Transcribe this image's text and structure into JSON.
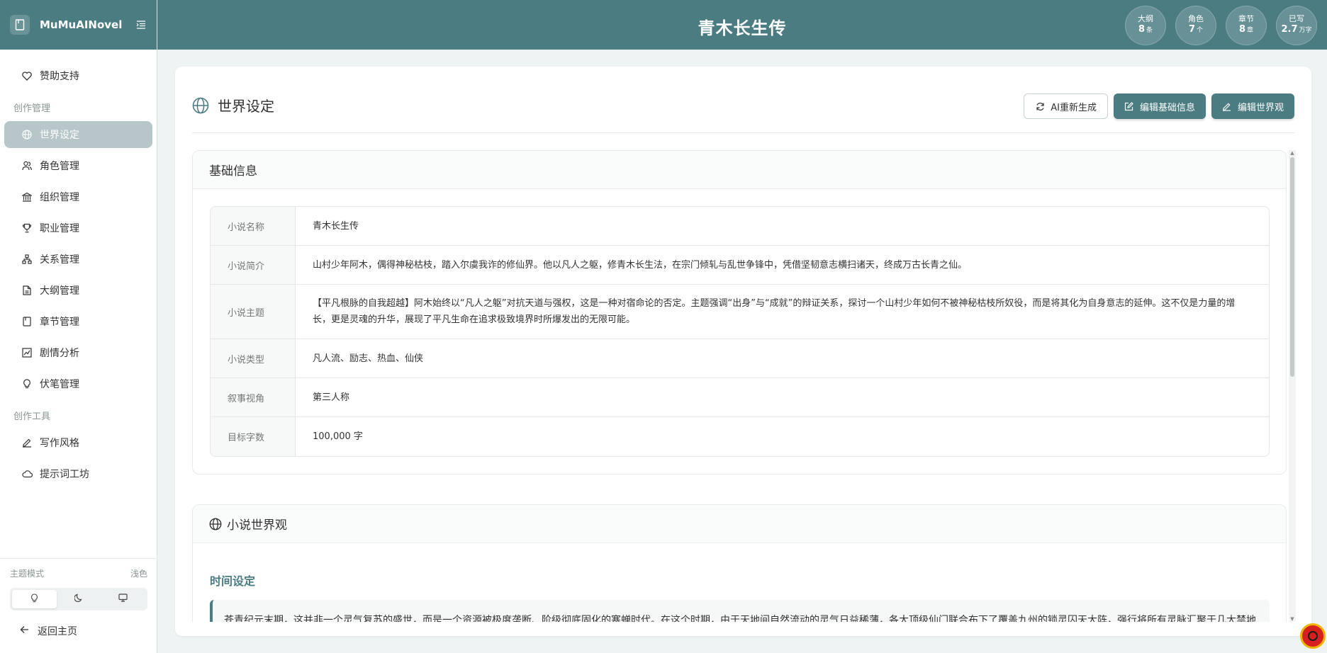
{
  "sidebar": {
    "brand": "MuMuAINovel",
    "items_top": [
      {
        "label": "赞助支持",
        "icon": "heart-icon"
      }
    ],
    "group1": "创作管理",
    "items_manage": [
      {
        "label": "世界设定",
        "icon": "globe-icon",
        "active": true
      },
      {
        "label": "角色管理",
        "icon": "users-icon"
      },
      {
        "label": "组织管理",
        "icon": "bank-icon"
      },
      {
        "label": "职业管理",
        "icon": "trophy-icon"
      },
      {
        "label": "关系管理",
        "icon": "network-icon"
      },
      {
        "label": "大纲管理",
        "icon": "file-icon"
      },
      {
        "label": "章节管理",
        "icon": "book-icon"
      },
      {
        "label": "剧情分析",
        "icon": "chart-icon"
      },
      {
        "label": "伏笔管理",
        "icon": "bulb-icon"
      }
    ],
    "group2": "创作工具",
    "items_tools": [
      {
        "label": "写作风格",
        "icon": "pen-icon"
      },
      {
        "label": "提示词工坊",
        "icon": "cloud-icon"
      }
    ],
    "theme_label": "主题模式",
    "theme_value": "浅色",
    "back_home": "返回主页"
  },
  "header": {
    "title": "青木长生传",
    "stats": [
      {
        "label": "大纲",
        "value": "8",
        "unit": "条"
      },
      {
        "label": "角色",
        "value": "7",
        "unit": "个"
      },
      {
        "label": "章节",
        "value": "8",
        "unit": "章"
      },
      {
        "label": "已写",
        "value": "2.7",
        "unit": "万字"
      }
    ]
  },
  "page": {
    "title": "世界设定",
    "btn_regen": "AI重新生成",
    "btn_edit_basic": "编辑基础信息",
    "btn_edit_world": "编辑世界观"
  },
  "basic": {
    "heading": "基础信息",
    "rows": [
      {
        "key": "小说名称",
        "value": "青木长生传"
      },
      {
        "key": "小说简介",
        "value": "山村少年阿木，偶得神秘枯枝，踏入尔虞我诈的修仙界。他以凡人之躯，修青木长生法，在宗门倾轧与乱世争锋中，凭借坚韧意志横扫诸天，终成万古长青之仙。"
      },
      {
        "key": "小说主题",
        "value": "【平凡根脉的自我超越】阿木始终以“凡人之躯”对抗天道与强权，这是一种对宿命论的否定。主题强调“出身”与“成就”的辩证关系，探讨一个山村少年如何不被神秘枯枝所奴役，而是将其化为自身意志的延伸。这不仅是力量的增长，更是灵魂的升华，展现了平凡生命在追求极致境界时所爆发出的无限可能。"
      },
      {
        "key": "小说类型",
        "value": "凡人流、励志、热血、仙侠"
      },
      {
        "key": "叙事视角",
        "value": "第三人称"
      },
      {
        "key": "目标字数",
        "value": "100,000 字"
      }
    ]
  },
  "world": {
    "heading": "小说世界观",
    "time_title": "时间设定",
    "time_text": "苍青纪元末期，这并非一个灵气复苏的盛世，而是一个资源被极度垄断、阶级彻底固化的寒蝉时代。在这个时期，由于天地间自然流动的灵气日益稀薄，各大顶级仙门联合布下了覆盖九州的锁灵囚天大阵，强行将所有灵脉汇聚于几大禁地之中，导致外界广袤的土地陷入了长达千年的灵气荒原。这种状态催生了极其严酷的社会生态：出生在山村或贫民窟的少年，若无上等灵根，终其一生连感知灵气的机会都没有。这不仅是力量的缺失，更是"
  }
}
